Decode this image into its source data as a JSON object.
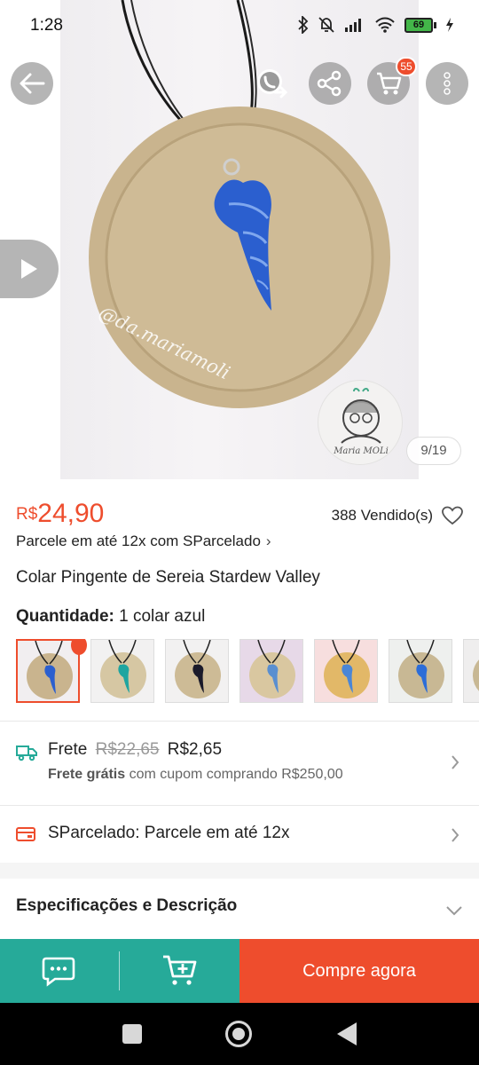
{
  "status_bar": {
    "time": "1:28",
    "battery": "69"
  },
  "gallery": {
    "counter": "9/19",
    "cart_count": "55",
    "watermark": "@da.mariamoli",
    "logo_text": "Maria MOLi"
  },
  "product": {
    "currency": "R$",
    "price": "24,90",
    "sold": "388 Vendido(s)",
    "installments": "Parcele em até 12x com SParcelado",
    "title": "Colar Pingente de Sereia Stardew Valley",
    "quantity_label": "Quantidade:",
    "quantity_value": "1 colar azul"
  },
  "thumbnails": [
    {
      "name": "thumb-1",
      "bg": "#f1eef0",
      "disc": "#c9b48e",
      "pendant": "#2b5fcf",
      "selected": true
    },
    {
      "name": "thumb-2",
      "bg": "#f2f1f1",
      "disc": "#d6c7a3",
      "pendant": "#1fa5a0",
      "selected": false
    },
    {
      "name": "thumb-3",
      "bg": "#f2f1f1",
      "disc": "#cdbb96",
      "pendant": "#1a1a2a",
      "selected": false
    },
    {
      "name": "thumb-4",
      "bg": "#e7d9e8",
      "disc": "#d9c7a0",
      "pendant": "#5a8fd0",
      "selected": false
    },
    {
      "name": "thumb-5",
      "bg": "#f7dede",
      "disc": "#e2b868",
      "pendant": "#4a86d6",
      "selected": false
    },
    {
      "name": "thumb-6",
      "bg": "#eef0ee",
      "disc": "#c8b894",
      "pendant": "#2c6dd8",
      "selected": false
    },
    {
      "name": "thumb-7",
      "bg": "#efeeee",
      "disc": "#c8b894",
      "pendant": "#3a70c8",
      "selected": false
    }
  ],
  "shipping": {
    "label": "Frete",
    "old_price": "R$22,65",
    "new_price": "R$2,65",
    "free_label": "Frete grátis",
    "free_condition": "com cupom comprando R$250,00"
  },
  "sparcelado": {
    "label": "SParcelado: Parcele em até 12x"
  },
  "specs": {
    "label": "Especificações e Descrição"
  },
  "bottom_bar": {
    "buy_label": "Compre agora"
  },
  "colors": {
    "accent": "#ee4d2d",
    "teal": "#26aa99",
    "pendant": "#2b5fcf"
  }
}
